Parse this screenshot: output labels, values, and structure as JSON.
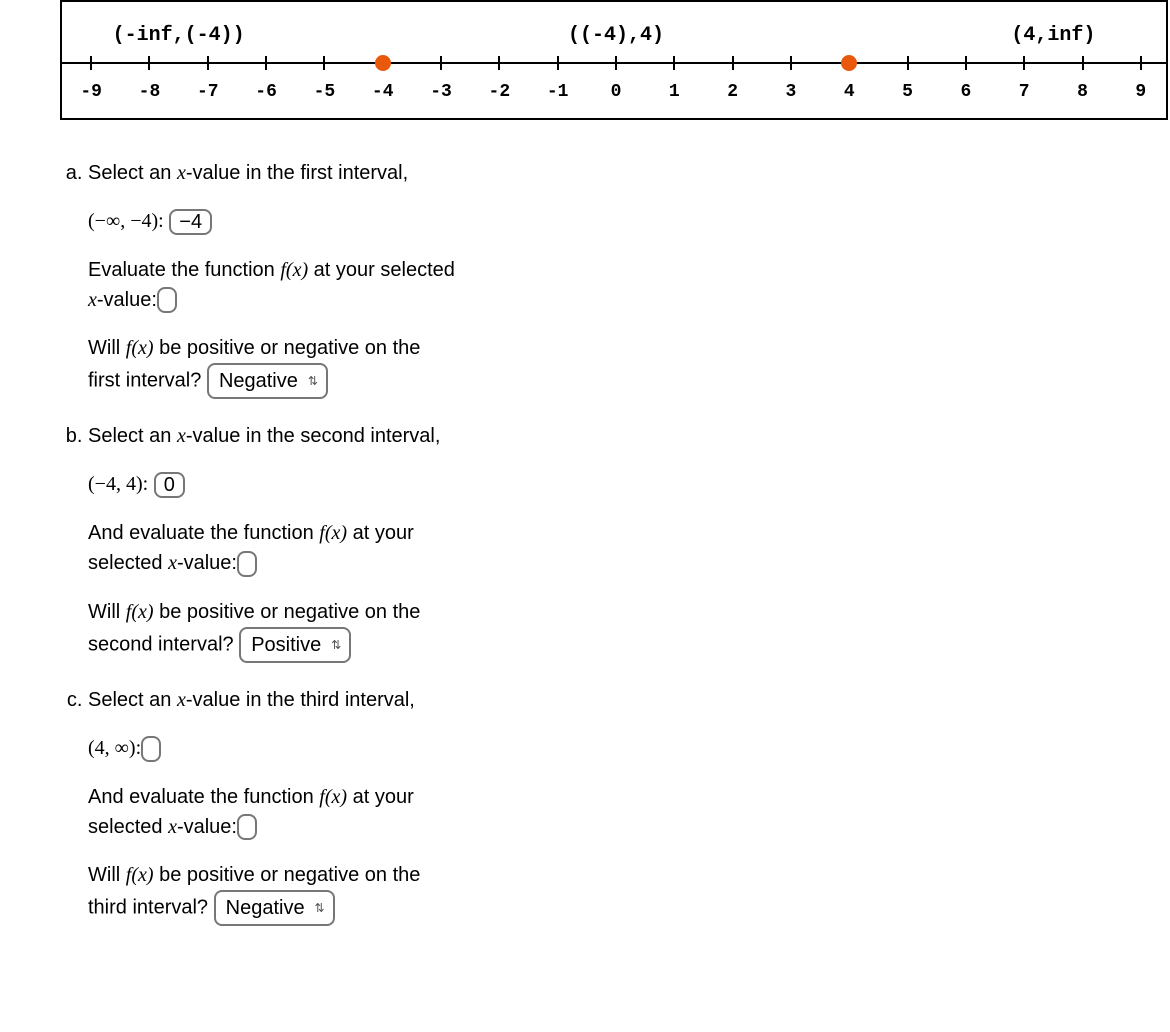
{
  "chart_data": {
    "type": "numberline",
    "intervals": [
      {
        "label": "(-inf,(-4))",
        "center_x": -7.5
      },
      {
        "label": "((-4),4)",
        "center_x": 0
      },
      {
        "label": "(4,inf)",
        "center_x": 7.5
      }
    ],
    "ticks": [
      -9,
      -8,
      -7,
      -6,
      -5,
      -4,
      -3,
      -2,
      -1,
      0,
      1,
      2,
      3,
      4,
      5,
      6,
      7,
      8,
      9
    ],
    "boundary_points": [
      -4,
      4
    ],
    "xlim": [
      -9.5,
      9.5
    ]
  },
  "q": {
    "a": {
      "prompt1_pre": "Select an ",
      "prompt1_var": "x",
      "prompt1_post": "-value in the first interval,",
      "interval": "(−∞, −4):",
      "xval": "−4",
      "eval_pre": "Evaluate the function ",
      "eval_fn": "f(x)",
      "eval_post": " at your selected",
      "xvalue_label_pre": "x",
      "xvalue_label_post": "-value:",
      "fval": "",
      "sign_pre": "Will ",
      "sign_fn": "f(x)",
      "sign_post": " be positive or negative on the",
      "sign_line2": "first interval?",
      "select": "Negative"
    },
    "b": {
      "prompt1_pre": "Select an ",
      "prompt1_var": "x",
      "prompt1_post": "-value in the second interval,",
      "interval": "(−4, 4):",
      "xval": "0",
      "eval_pre": "And evaluate the function ",
      "eval_fn": "f(x)",
      "eval_post": " at your",
      "xvalue_label_pre": "selected ",
      "xvalue_label_var": "x",
      "xvalue_label_post": "-value:",
      "fval": "",
      "sign_pre": "Will ",
      "sign_fn": "f(x)",
      "sign_post": " be positive or negative on the",
      "sign_line2": "second interval?",
      "select": "Positive"
    },
    "c": {
      "prompt1_pre": "Select an ",
      "prompt1_var": "x",
      "prompt1_post": "-value in the third interval,",
      "interval": "(4, ∞):",
      "xval": "",
      "eval_pre": "And evaluate the function ",
      "eval_fn": "f(x)",
      "eval_post": " at your",
      "xvalue_label_pre": "selected ",
      "xvalue_label_var": "x",
      "xvalue_label_post": "-value:",
      "fval": "",
      "sign_pre": "Will ",
      "sign_fn": "f(x)",
      "sign_post": " be positive or negative on the",
      "sign_line2": "third interval?",
      "select": "Negative"
    }
  }
}
